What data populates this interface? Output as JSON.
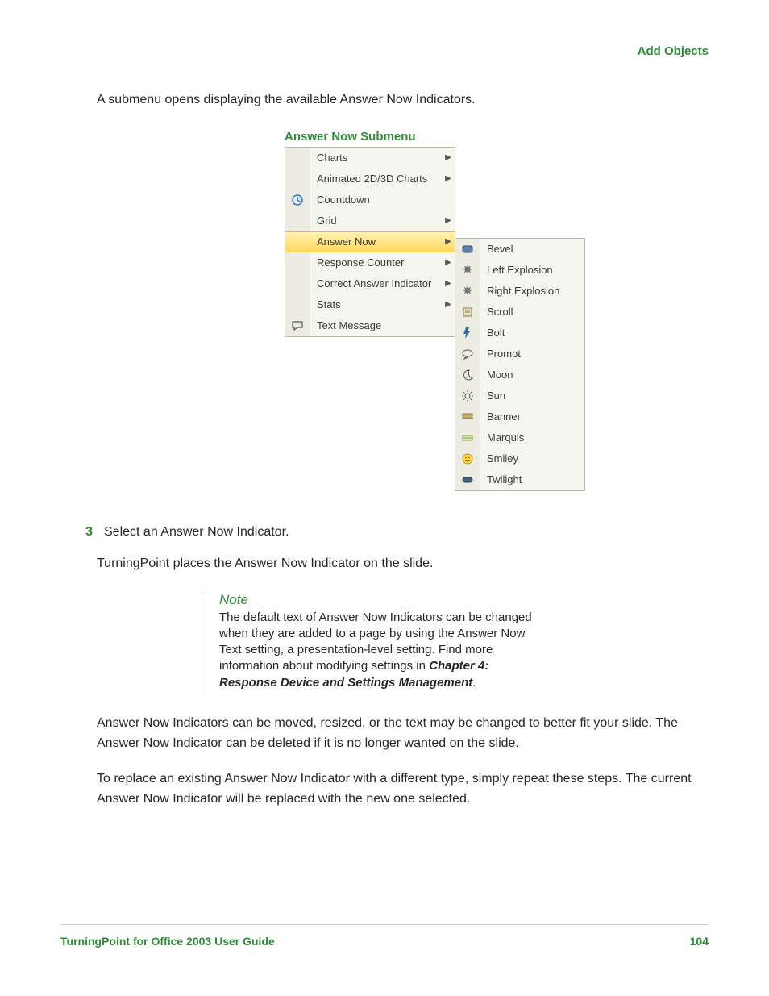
{
  "header": {
    "section": "Add Objects"
  },
  "intro": "A submenu opens displaying the available Answer Now Indicators.",
  "figure_caption": "Answer Now Submenu",
  "menu": {
    "items": [
      {
        "label": "Charts",
        "arrow": true,
        "icon": ""
      },
      {
        "label": "Animated 2D/3D Charts",
        "arrow": true,
        "icon": ""
      },
      {
        "label": "Countdown",
        "arrow": false,
        "icon": "clock"
      },
      {
        "label": "Grid",
        "arrow": true,
        "icon": ""
      },
      {
        "label": "Answer Now",
        "arrow": true,
        "icon": "",
        "highlight": true
      },
      {
        "label": "Response Counter",
        "arrow": true,
        "icon": ""
      },
      {
        "label": "Correct Answer Indicator",
        "arrow": true,
        "icon": ""
      },
      {
        "label": "Stats",
        "arrow": true,
        "icon": ""
      },
      {
        "label": "Text Message",
        "arrow": false,
        "icon": "message"
      }
    ]
  },
  "submenu": {
    "items": [
      {
        "label": "Bevel",
        "icon": "bevel"
      },
      {
        "label": "Left Explosion",
        "icon": "burst"
      },
      {
        "label": "Right Explosion",
        "icon": "burst"
      },
      {
        "label": "Scroll",
        "icon": "scroll"
      },
      {
        "label": "Bolt",
        "icon": "bolt"
      },
      {
        "label": "Prompt",
        "icon": "prompt"
      },
      {
        "label": "Moon",
        "icon": "moon"
      },
      {
        "label": "Sun",
        "icon": "sun"
      },
      {
        "label": "Banner",
        "icon": "banner"
      },
      {
        "label": "Marquis",
        "icon": "marquis"
      },
      {
        "label": "Smiley",
        "icon": "smiley"
      },
      {
        "label": "Twilight",
        "icon": "twilight"
      }
    ]
  },
  "step": {
    "num": "3",
    "text": "Select an Answer Now Indicator."
  },
  "after_step": "TurningPoint places the Answer Now Indicator on the slide.",
  "note": {
    "title": "Note",
    "body_pre": "The default text of Answer Now Indicators can be changed when they are added to a page by using the Answer Now Text setting, a presentation-level setting. Find more information about modifying settings in ",
    "body_bold": "Chapter 4: Response Device and Settings Management",
    "body_post": "."
  },
  "para2": "Answer Now Indicators can be moved, resized, or the text may be changed to better fit your slide. The Answer Now Indicator can be deleted if it is no longer wanted on the slide.",
  "para3": "To replace an existing Answer Now Indicator with a different type, simply repeat these steps. The current Answer Now Indicator will be replaced with the new one selected.",
  "footer": {
    "left": "TurningPoint for Office 2003 User Guide",
    "right": "104"
  }
}
